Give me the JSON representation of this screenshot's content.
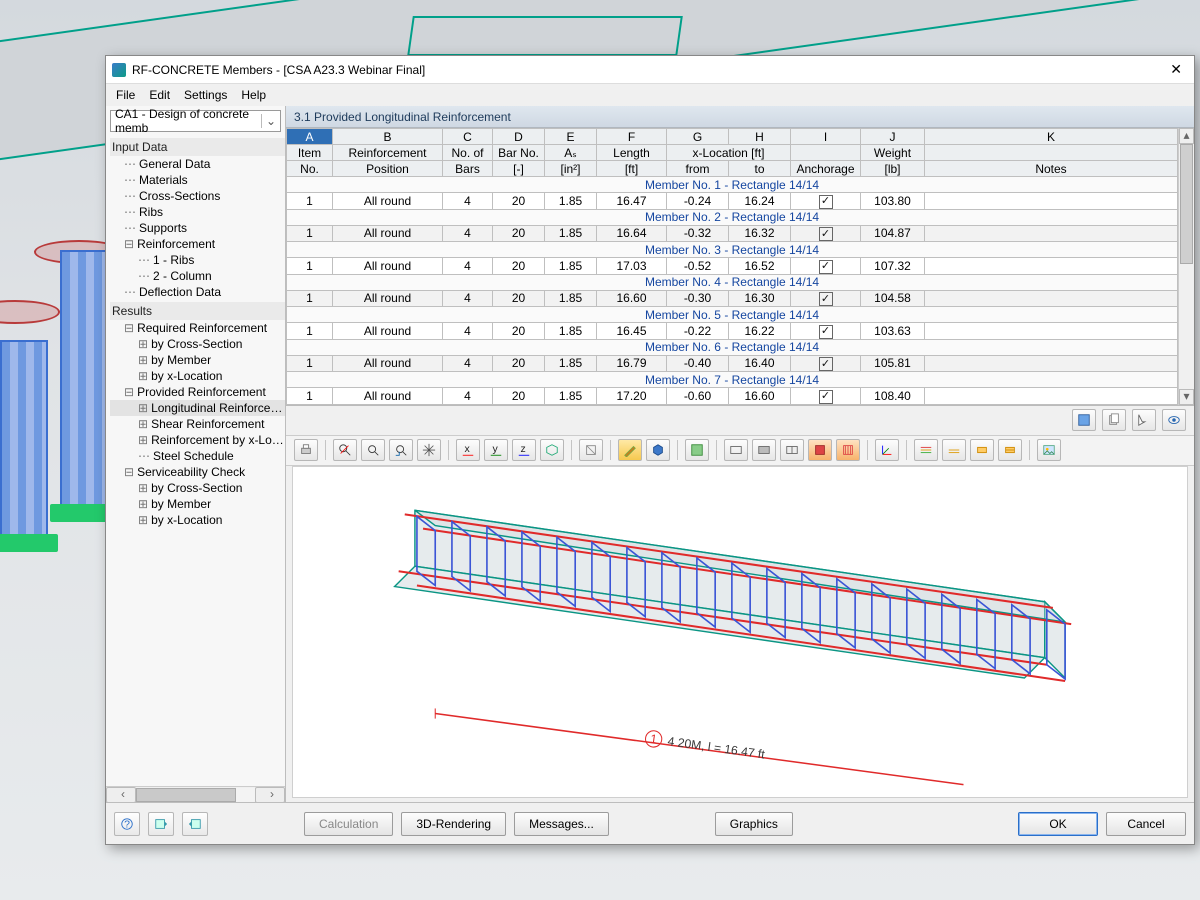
{
  "window": {
    "title": "RF-CONCRETE Members - [CSA A23.3 Webinar Final]"
  },
  "menu": {
    "items": [
      "File",
      "Edit",
      "Settings",
      "Help"
    ]
  },
  "sidebar": {
    "combo": "CA1 - Design of concrete memb",
    "input_header": "Input Data",
    "results_header": "Results",
    "input": [
      "General Data",
      "Materials",
      "Cross-Sections",
      "Ribs",
      "Supports",
      "Reinforcement",
      "1 - Ribs",
      "2 - Column",
      "Deflection Data"
    ],
    "required": {
      "label": "Required Reinforcement",
      "items": [
        "by Cross-Section",
        "by Member",
        "by x-Location"
      ]
    },
    "provided": {
      "label": "Provided Reinforcement",
      "items": [
        "Longitudinal Reinforcement",
        "Shear Reinforcement",
        "Reinforcement by x-Location",
        "Steel Schedule"
      ]
    },
    "service": {
      "label": "Serviceability Check",
      "items": [
        "by Cross-Section",
        "by Member",
        "by x-Location"
      ]
    }
  },
  "pane": {
    "title": "3.1 Provided Longitudinal Reinforcement"
  },
  "columns": {
    "letters": [
      "A",
      "B",
      "C",
      "D",
      "E",
      "F",
      "G",
      "H",
      "I",
      "J",
      "K"
    ],
    "h1": [
      "Item",
      "Reinforcement",
      "No. of",
      "Bar No.",
      "Aₛ",
      "Length",
      "x-Location [ft]",
      "",
      "",
      "Weight",
      ""
    ],
    "h2": [
      "No.",
      "Position",
      "Bars",
      "[-]",
      "[in²]",
      "[ft]",
      "from",
      "to",
      "Anchorage",
      "[lb]",
      "Notes"
    ]
  },
  "rows": [
    {
      "member": "Member No. 1  -  Rectangle 14/14",
      "item": "1",
      "pos": "All round",
      "bars": "4",
      "barno": "20",
      "as": "1.85",
      "len": "16.47",
      "from": "-0.24",
      "to": "16.24",
      "anch": true,
      "wt": "103.80"
    },
    {
      "member": "Member No. 2  -  Rectangle 14/14",
      "item": "1",
      "pos": "All round",
      "bars": "4",
      "barno": "20",
      "as": "1.85",
      "len": "16.64",
      "from": "-0.32",
      "to": "16.32",
      "anch": true,
      "wt": "104.87"
    },
    {
      "member": "Member No. 3  -  Rectangle 14/14",
      "item": "1",
      "pos": "All round",
      "bars": "4",
      "barno": "20",
      "as": "1.85",
      "len": "17.03",
      "from": "-0.52",
      "to": "16.52",
      "anch": true,
      "wt": "107.32"
    },
    {
      "member": "Member No. 4  -  Rectangle 14/14",
      "item": "1",
      "pos": "All round",
      "bars": "4",
      "barno": "20",
      "as": "1.85",
      "len": "16.60",
      "from": "-0.30",
      "to": "16.30",
      "anch": true,
      "wt": "104.58"
    },
    {
      "member": "Member No. 5  -  Rectangle 14/14",
      "item": "1",
      "pos": "All round",
      "bars": "4",
      "barno": "20",
      "as": "1.85",
      "len": "16.45",
      "from": "-0.22",
      "to": "16.22",
      "anch": true,
      "wt": "103.63"
    },
    {
      "member": "Member No. 6  -  Rectangle 14/14",
      "item": "1",
      "pos": "All round",
      "bars": "4",
      "barno": "20",
      "as": "1.85",
      "len": "16.79",
      "from": "-0.40",
      "to": "16.40",
      "anch": true,
      "wt": "105.81"
    },
    {
      "member": "Member No. 7  -  Rectangle 14/14",
      "item": "1",
      "pos": "All round",
      "bars": "4",
      "barno": "20",
      "as": "1.85",
      "len": "17.20",
      "from": "-0.60",
      "to": "16.60",
      "anch": true,
      "wt": "108.40"
    }
  ],
  "render_label": "4 20M, l = 16.47 ft",
  "render_badge": "1",
  "footer": {
    "calc": "Calculation",
    "render": "3D-Rendering",
    "msgs": "Messages...",
    "graphics": "Graphics",
    "ok": "OK",
    "cancel": "Cancel"
  }
}
